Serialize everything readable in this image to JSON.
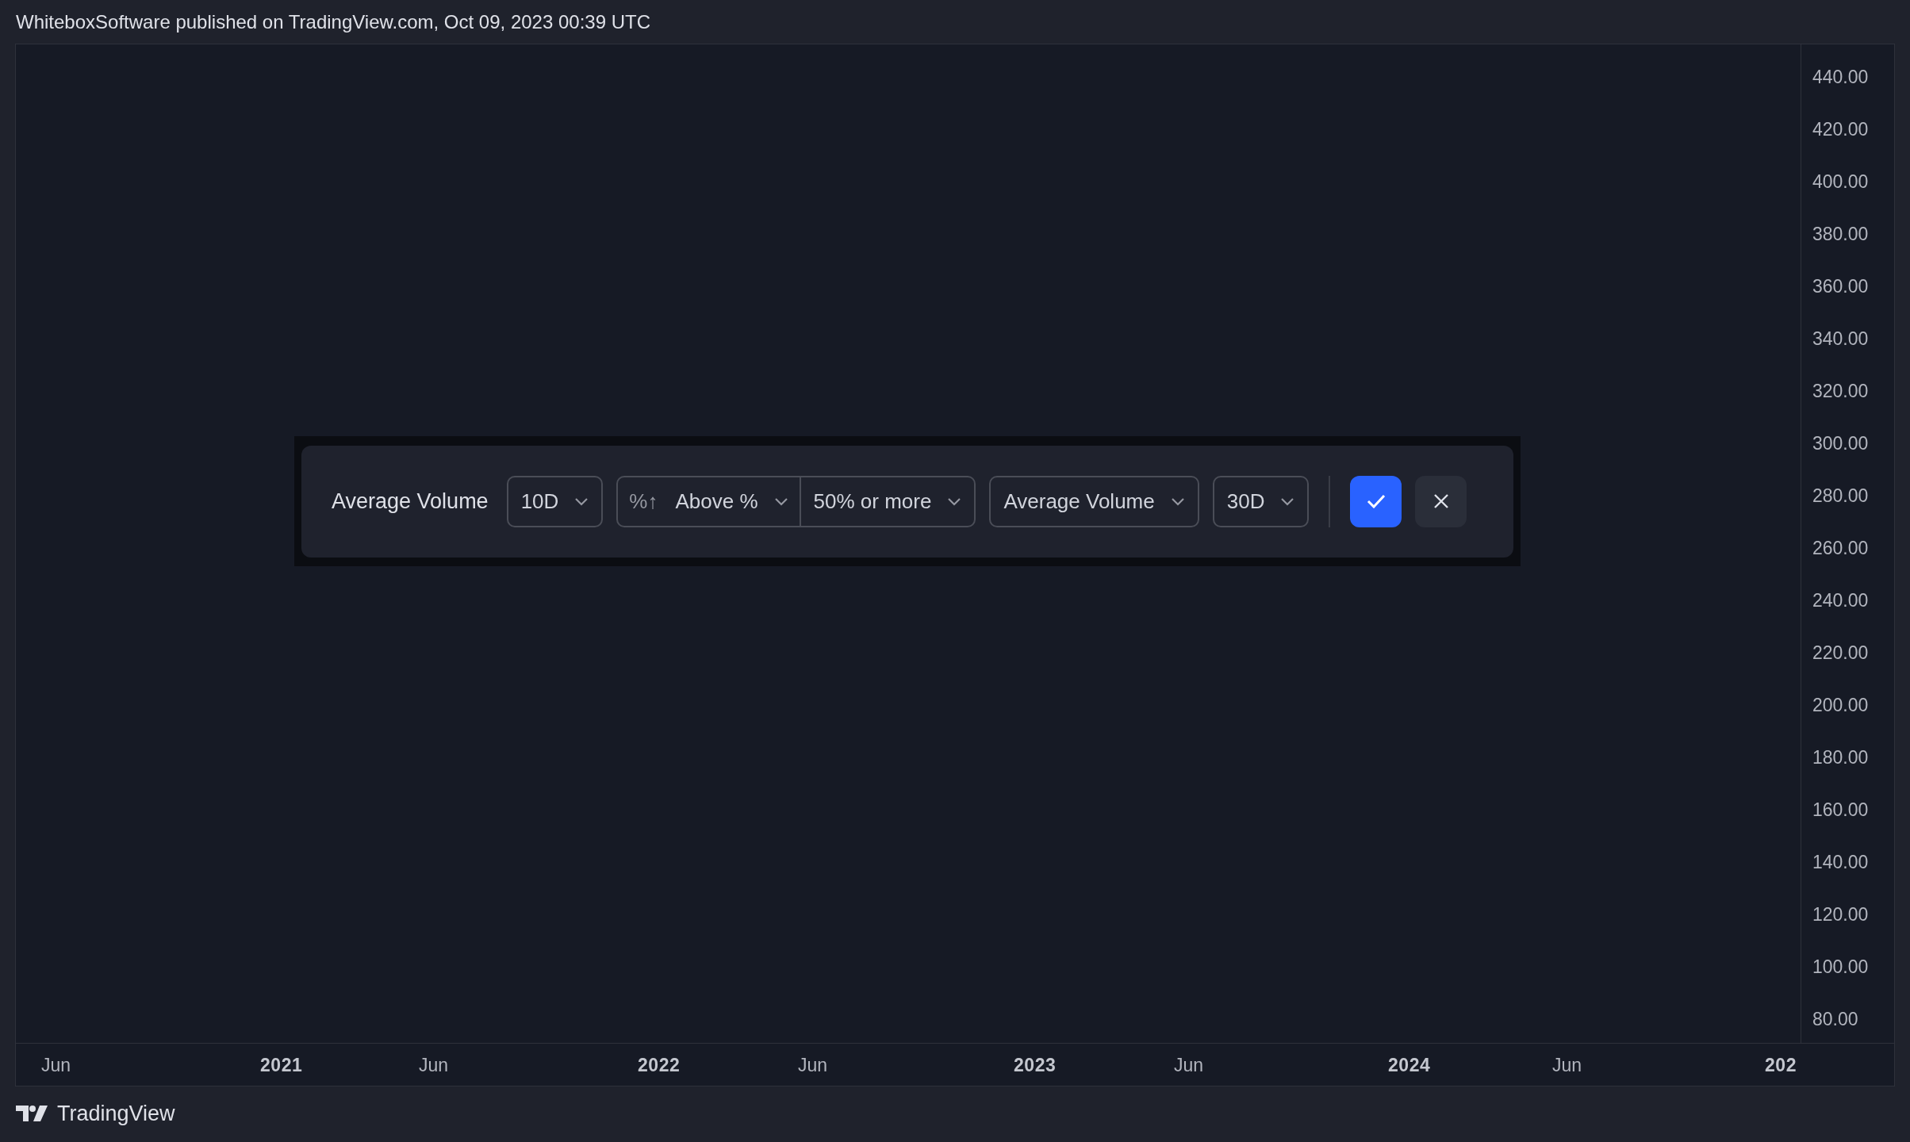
{
  "header": {
    "text": "WhiteboxSoftware published on TradingView.com, Oct 09, 2023 00:39 UTC"
  },
  "price_axis": [
    "440.00",
    "420.00",
    "400.00",
    "380.00",
    "360.00",
    "340.00",
    "320.00",
    "300.00",
    "280.00",
    "260.00",
    "240.00",
    "220.00",
    "200.00",
    "180.00",
    "160.00",
    "140.00",
    "120.00",
    "100.00",
    "80.00"
  ],
  "time_axis": [
    {
      "label": "Jun",
      "kind": "month"
    },
    {
      "label": "2021",
      "kind": "year"
    },
    {
      "label": "Jun",
      "kind": "month"
    },
    {
      "label": "2022",
      "kind": "year"
    },
    {
      "label": "Jun",
      "kind": "month"
    },
    {
      "label": "2023",
      "kind": "year"
    },
    {
      "label": "Jun",
      "kind": "month"
    },
    {
      "label": "2024",
      "kind": "year"
    },
    {
      "label": "Jun",
      "kind": "month"
    },
    {
      "label": "202",
      "kind": "year"
    }
  ],
  "filter": {
    "label": "Average Volume",
    "controls": [
      {
        "kind": "dropdown",
        "value": "10D"
      },
      {
        "kind": "compare",
        "icon": "%↑",
        "value": "Above %"
      },
      {
        "kind": "joined",
        "value": "50% or more"
      },
      {
        "kind": "dropdown",
        "value": "Average Volume"
      },
      {
        "kind": "dropdown",
        "value": "30D"
      }
    ]
  },
  "footer": {
    "brand": "TradingView"
  }
}
